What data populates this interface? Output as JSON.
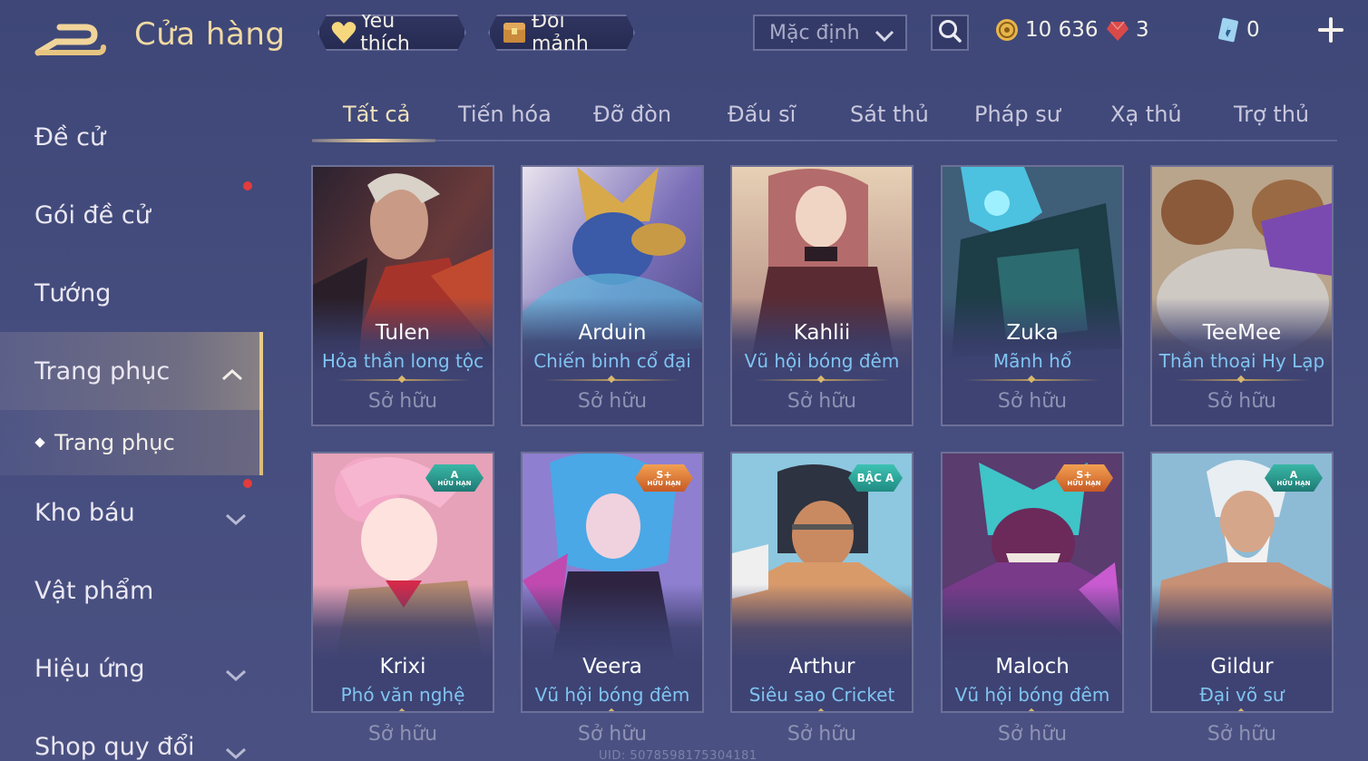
{
  "header": {
    "title": "Cửa hàng",
    "favorites_label": "Yêu thích",
    "exchange_label": "Đổi mảnh",
    "sort_value": "Mặc định",
    "currencies": {
      "gold": "10 636",
      "ruby": "3",
      "voucher": "0"
    }
  },
  "sidebar": {
    "items": [
      {
        "label": "Đề cử"
      },
      {
        "label": "Gói đề cử"
      },
      {
        "label": "Tướng"
      },
      {
        "label": "Trang phục"
      },
      {
        "label": "Kho báu"
      },
      {
        "label": "Vật phẩm"
      },
      {
        "label": "Hiệu ứng"
      },
      {
        "label": "Shop quy đổi"
      }
    ],
    "sub_item": "Trang phục"
  },
  "tabs": [
    "Tất cả",
    "Tiến hóa",
    "Đỡ đòn",
    "Đấu sĩ",
    "Sát thủ",
    "Pháp sư",
    "Xạ thủ",
    "Trợ thủ"
  ],
  "cards": [
    {
      "hero": "Tulen",
      "skin": "Hỏa thần long tộc",
      "status": "Sở hữu",
      "badge": null
    },
    {
      "hero": "Arduin",
      "skin": "Chiến binh cổ đại",
      "status": "Sở hữu",
      "badge": null
    },
    {
      "hero": "Kahlii",
      "skin": "Vũ hội bóng đêm",
      "status": "Sở hữu",
      "badge": null
    },
    {
      "hero": "Zuka",
      "skin": "Mãnh hổ",
      "status": "Sở hữu",
      "badge": null
    },
    {
      "hero": "TeeMee",
      "skin": "Thần thoại Hy Lạp",
      "status": "Sở hữu",
      "badge": null
    },
    {
      "hero": "Krixi",
      "skin": "Phó văn nghệ",
      "status": "Sở hữu",
      "badge": {
        "top": "A",
        "bottom": "HỮU HẠN"
      }
    },
    {
      "hero": "Veera",
      "skin": "Vũ hội bóng đêm",
      "status": "Sở hữu",
      "badge": {
        "top": "S+",
        "bottom": "HỮU HẠN"
      }
    },
    {
      "hero": "Arthur",
      "skin": "Siêu sao Cricket",
      "status": "Sở hữu",
      "badge": {
        "top": "BẬC A",
        "bottom": ""
      }
    },
    {
      "hero": "Maloch",
      "skin": "Vũ hội bóng đêm",
      "status": "Sở hữu",
      "badge": {
        "top": "S+",
        "bottom": "HỮU HẠN"
      }
    },
    {
      "hero": "Gildur",
      "skin": "Đại võ sư",
      "status": "Sở hữu",
      "badge": {
        "top": "A",
        "bottom": "HỮU HẠN"
      }
    }
  ],
  "uid_text": "UID: 5078598175304181",
  "colors": {
    "background": "#434b7c",
    "gold_accent": "#f0d9a4",
    "skin_name": "#7fc4f2",
    "owned": "#8f92b3",
    "notification": "#e23c3c"
  }
}
